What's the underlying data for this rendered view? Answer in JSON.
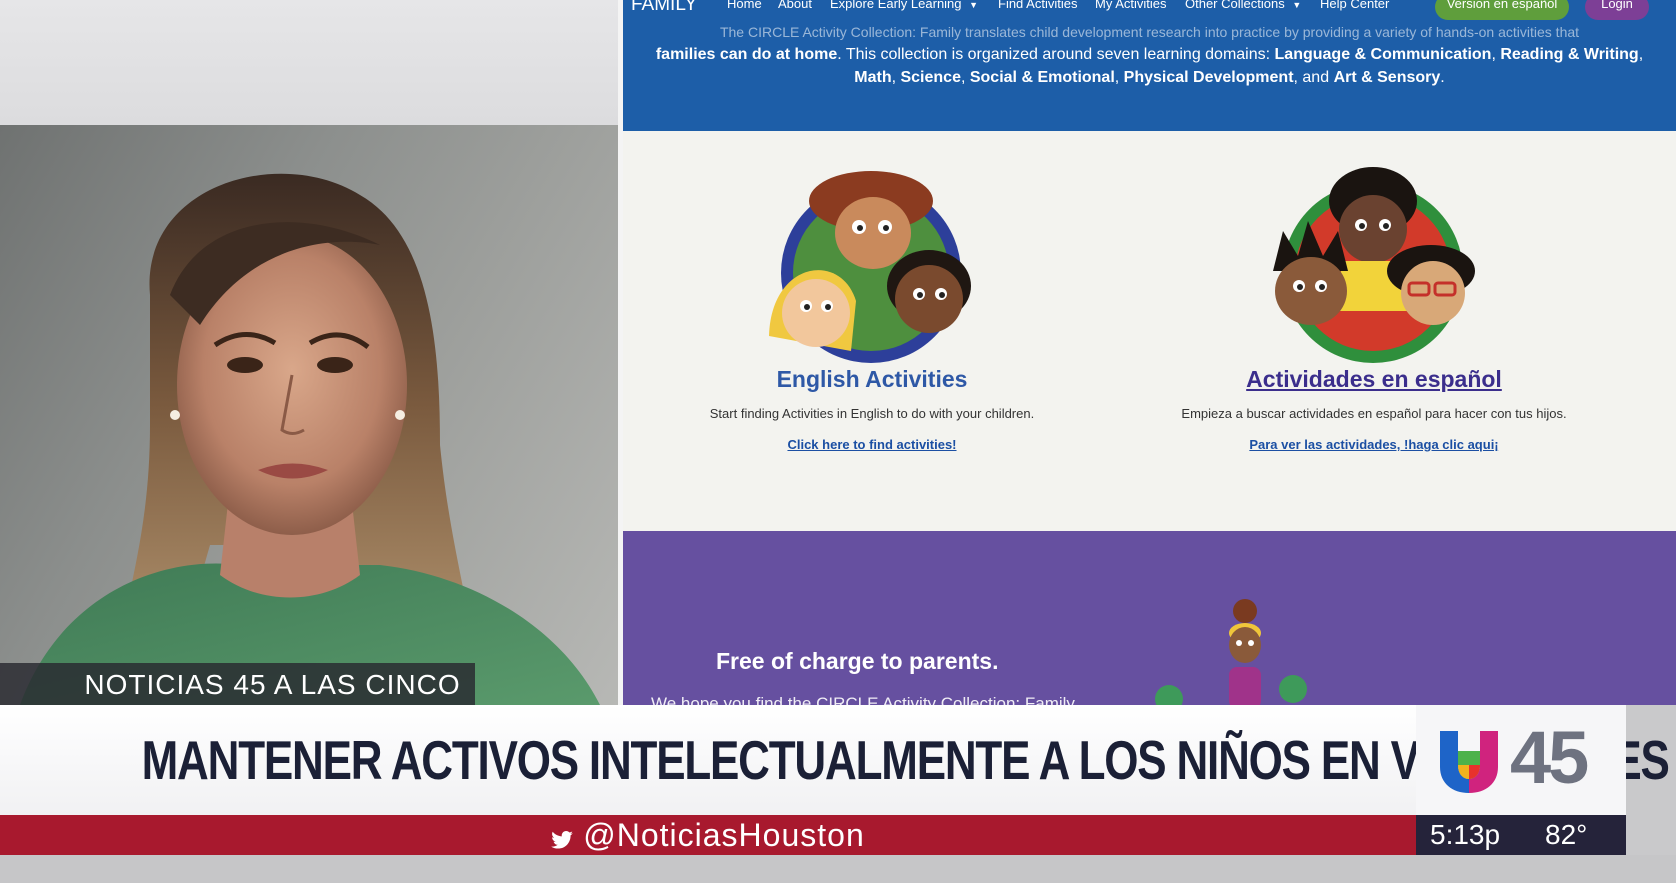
{
  "website": {
    "brand_fragment": "FAMILY",
    "nav": {
      "home": "Home",
      "about": "About",
      "explore": "Explore Early Learning",
      "find": "Find Activities",
      "my": "My Activities",
      "other": "Other Collections",
      "help": "Help Center",
      "spanish_button": "Version en español",
      "login_button": "Login"
    },
    "hero": {
      "line1": "The CIRCLE Activity Collection: Family translates child development research into practice by providing a variety of hands-on activities that",
      "line2_bold": "families can do at home",
      "line2_rest": ". This collection is organized around seven learning domains:",
      "domains": [
        "Language & Communication",
        "Reading & Writing",
        "Math",
        "Science",
        "Social & Emotional",
        "Physical Development",
        "Art & Sensory"
      ],
      "and_word": "and",
      "period": "."
    },
    "english": {
      "title": "English Activities",
      "description": "Start finding Activities in English to do with your children.",
      "link": "Click here to find activities!"
    },
    "spanish": {
      "title": "Actividades en español",
      "description": "Empieza a buscar actividades en español para hacer con tus hijos.",
      "link": "Para ver las actividades, !haga clic aqui¡"
    },
    "purple": {
      "heading": "Free of charge to parents.",
      "text": "We hope you find the CIRCLE Activity Collection: Family"
    }
  },
  "broadcast": {
    "show_name": "NOTICIAS 45 A LAS CINCO",
    "headline": "MANTENER ACTIVOS INTELECTUALMENTE A LOS NIÑOS EN VACACIONES",
    "twitter_handle": "@NoticiasHouston",
    "channel_number": "45",
    "time": "5:13p",
    "temperature": "82°"
  },
  "colors": {
    "site_blue": "#1d5ea8",
    "site_purple": "#6650a0",
    "spanish_button": "#5f9e3c",
    "login_button": "#7d3f96",
    "ticker_red": "#a8192e",
    "headline_text": "#1b2036"
  },
  "icons": [
    "twitter-icon",
    "univision-logo-icon",
    "chevron-down-icon"
  ]
}
